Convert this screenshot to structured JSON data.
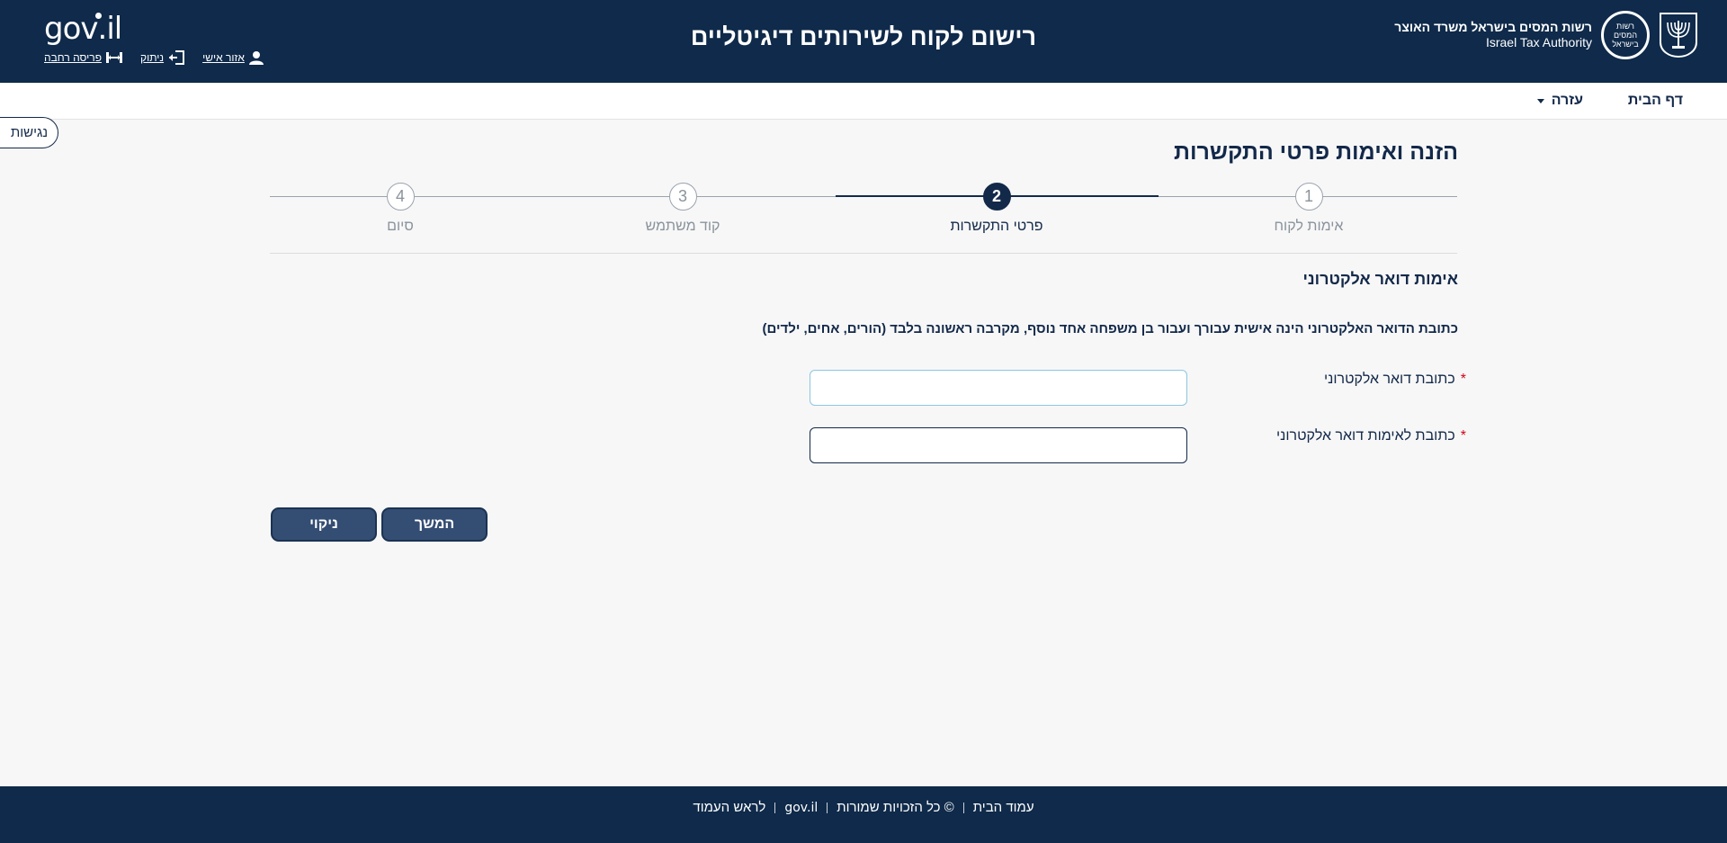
{
  "header": {
    "title": "רישום לקוח לשירותים דיגיטליים",
    "gov_logo": "gov.il",
    "links": {
      "personal_area": "אזור אישי",
      "logout": "ניתוק",
      "wide_layout": "פריסה רחבה"
    },
    "authority_he": "רשות המסים בישראל משרד האוצר",
    "authority_en": "Israel Tax Authority",
    "authority_logo_text": "רשות המסים בישראל"
  },
  "nav": {
    "home": "דף הבית",
    "help": "עזרה"
  },
  "accessibility": "נגישות",
  "page_title": "הזנה ואימות פרטי התקשרות",
  "steps": [
    {
      "number": "1",
      "label": "אימות לקוח"
    },
    {
      "number": "2",
      "label": "פרטי התקשרות"
    },
    {
      "number": "3",
      "label": "קוד משתמש"
    },
    {
      "number": "4",
      "label": "סיום"
    }
  ],
  "active_step": 2,
  "section_title": "אימות דואר אלקטרוני",
  "note": "כתובת הדואר האלקטרוני הינה אישית עבורך ועבור בן משפחה אחד נוסף, מקרבה ראשונה בלבד (הורים, אחים, ילדים)",
  "form": {
    "email_label": "כתובת דואר אלקטרוני",
    "email_value": "",
    "confirm_label": "כתובת לאימות דואר אלקטרוני",
    "confirm_value": "",
    "required_mark": "*"
  },
  "buttons": {
    "next": "המשך",
    "clear": "ניקוי"
  },
  "footer": {
    "home": "עמוד הבית",
    "rights": "© כל הזכויות שמורות",
    "gov": "gov.il",
    "top": "לראש העמוד"
  },
  "colors": {
    "primary": "#0f2a4a",
    "button": "#344d73",
    "required": "#d0021b",
    "background": "#f7f7f7"
  }
}
